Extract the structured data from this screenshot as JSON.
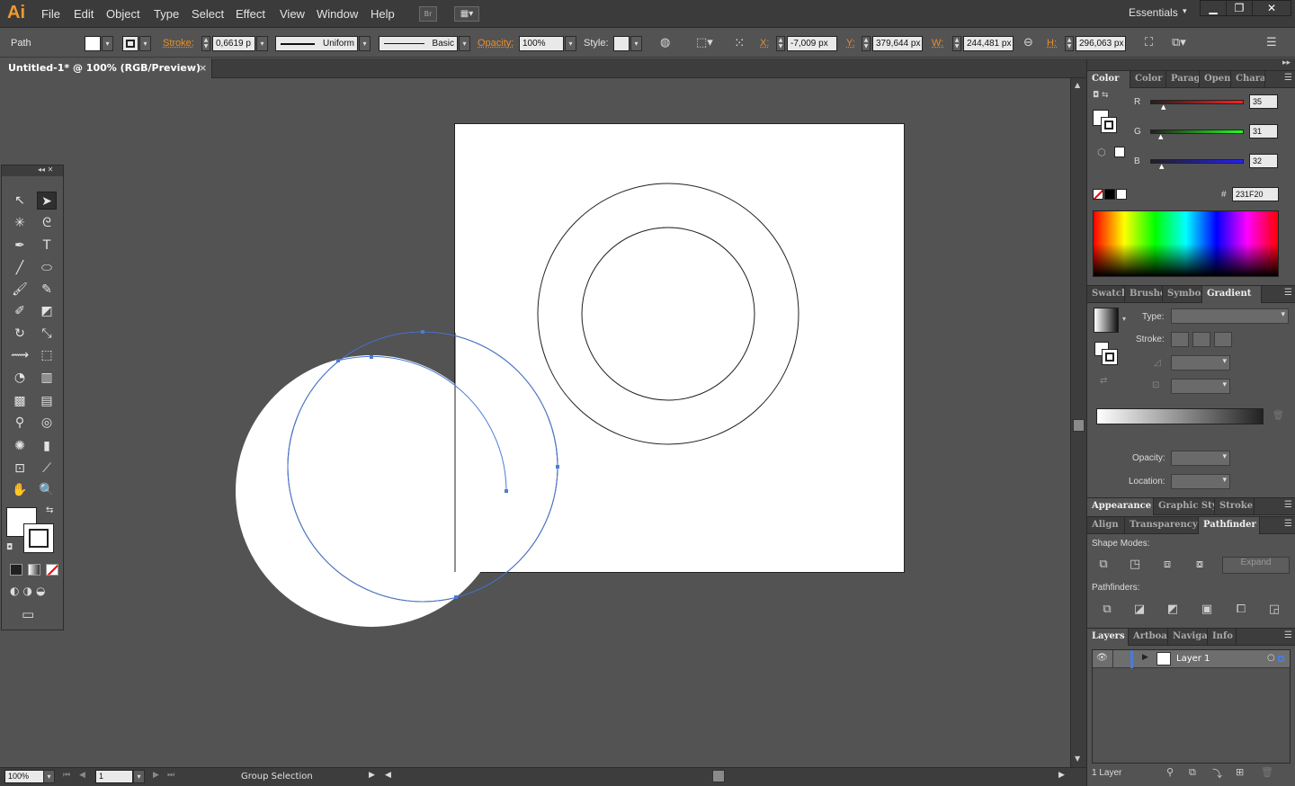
{
  "app": {
    "logo": "Ai",
    "workspace": "Essentials",
    "bridge_label": "Br"
  },
  "menu": [
    "File",
    "Edit",
    "Object",
    "Type",
    "Select",
    "Effect",
    "View",
    "Window",
    "Help"
  ],
  "control": {
    "selection_type": "Path",
    "stroke_label": "Stroke:",
    "stroke_value": "0,6619 p",
    "stroke_profile": "Uniform",
    "brush": "Basic",
    "opacity_label": "Opacity:",
    "opacity_value": "100%",
    "style_label": "Style:",
    "x_label": "X:",
    "x_value": "-7,009 px",
    "y_label": "Y:",
    "y_value": "379,644 px",
    "w_label": "W:",
    "w_value": "244,481 px",
    "h_label": "H:",
    "h_value": "296,063 px"
  },
  "document": {
    "tab_title": "Untitled-1* @ 100% (RGB/Preview)",
    "close": "×"
  },
  "status": {
    "zoom": "100%",
    "artboard": "1",
    "tool": "Group Selection"
  },
  "color_panel": {
    "tabs": [
      "Color",
      "Color",
      "Parag",
      "OpenT",
      "Chara"
    ],
    "r_label": "R",
    "r_value": "35",
    "g_label": "G",
    "g_value": "31",
    "b_label": "B",
    "b_value": "32",
    "hex_label": "#",
    "hex_value": "231F20"
  },
  "gradient_panel": {
    "tabs": [
      "Swatch",
      "Brushe",
      "Symbol",
      "Gradient"
    ],
    "type_label": "Type:",
    "stroke_label": "Stroke:",
    "opacity_label": "Opacity:",
    "location_label": "Location:"
  },
  "appearance_tabs": [
    "Appearance",
    "Graphic Styl",
    "Stroke"
  ],
  "pathfinder_panel": {
    "tabs": [
      "Align",
      "Transparency",
      "Pathfinder"
    ],
    "shape_modes_label": "Shape Modes:",
    "expand_label": "Expand",
    "pathfinders_label": "Pathfinders:"
  },
  "layers_panel": {
    "tabs": [
      "Layers",
      "Artboar",
      "Navigat",
      "Info"
    ],
    "layer_name": "Layer 1",
    "count": "1 Layer"
  },
  "colors": {
    "accent": "#4b7bd8",
    "logo": "#ef9a2e",
    "label_orange": "#e98f2c"
  }
}
